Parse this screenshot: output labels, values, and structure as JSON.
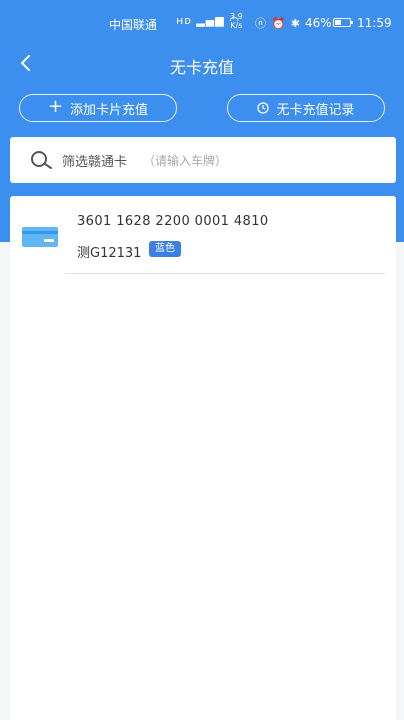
{
  "status_bar": {
    "carrier": "中国联通",
    "speed_value": "3.9",
    "speed_unit": "K/s",
    "battery_percent": "46%",
    "battery_level": 0.46,
    "time": "11:59"
  },
  "header": {
    "title": "无卡充值"
  },
  "actions": {
    "add_card_label": "添加卡片充值",
    "record_label": "无卡充值记录"
  },
  "search": {
    "label": "筛选赣通卡",
    "hint": "（请输入车牌）"
  },
  "cards": [
    {
      "number": "3601 1628 2200 0001 4810",
      "plate": "测G12131",
      "color_tag": "蓝色"
    }
  ],
  "colors": {
    "primary": "#3d8fef",
    "badge": "#3d7fe3",
    "card_icon": "#5fb7f3"
  },
  "icons": [
    "back-arrow-icon",
    "plus-icon",
    "clock-icon",
    "search-icon",
    "card-icon"
  ]
}
